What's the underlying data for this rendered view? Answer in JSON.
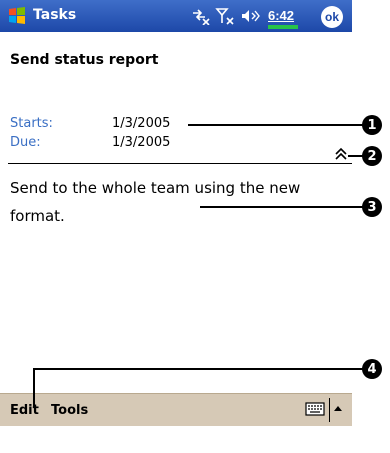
{
  "title_bar": {
    "app_title": "Tasks",
    "time": "6:42",
    "ok_label": "ok",
    "icons": [
      "windows-start-icon",
      "connectivity-icon",
      "signal-off-icon",
      "speaker-icon"
    ]
  },
  "task": {
    "subject": "Send status report",
    "starts_label": "Starts:",
    "starts_value": "1/3/2005",
    "due_label": "Due:",
    "due_value": "1/3/2005",
    "notes": "Send to the whole team using the new format."
  },
  "menu_bar": {
    "edit_label": "Edit",
    "tools_label": "Tools",
    "icons": [
      "keyboard-icon",
      "up-arrow-icon"
    ]
  },
  "callouts": [
    "1",
    "2",
    "3",
    "4"
  ],
  "colors": {
    "title_bar": "#1d48a8",
    "field_label": "#3a6fc4",
    "menu_bar": "#d6c9b6",
    "battery": "#27c34a"
  }
}
